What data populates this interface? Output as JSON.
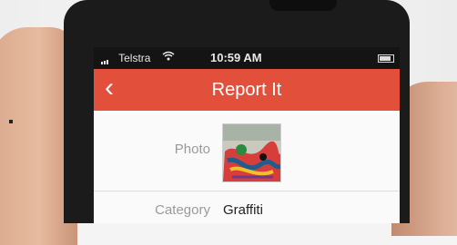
{
  "status_bar": {
    "carrier": "Telstra",
    "time": "10:59 AM"
  },
  "nav": {
    "title": "Report It",
    "back_icon": "chevron-left-icon"
  },
  "form": {
    "photo_label": "Photo",
    "category_label": "Category",
    "category_value": "Graffiti"
  },
  "colors": {
    "accent": "#e2503b"
  }
}
